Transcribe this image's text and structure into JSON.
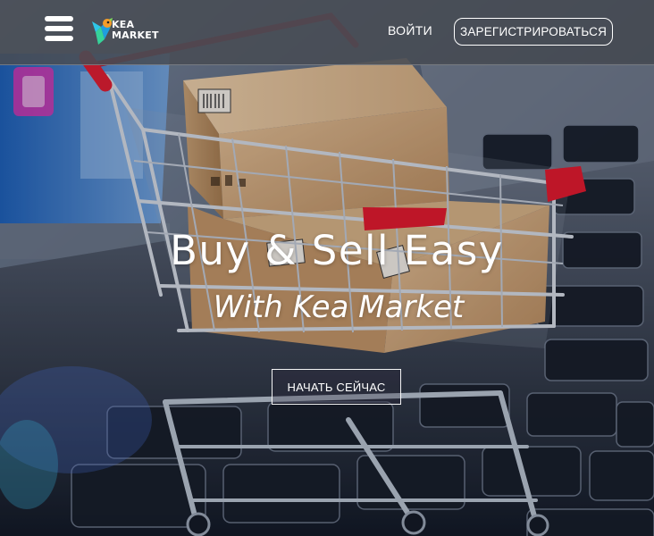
{
  "header": {
    "logo_line1": "KEA",
    "logo_line2": "MARKET",
    "login_label": "ВОЙТИ",
    "register_label": "ЗАРЕГИСТРИРОВАТЬСЯ"
  },
  "hero": {
    "title": "Buy & Sell Easy",
    "subtitle": "With Kea Market",
    "cta_label": "НАЧАТЬ СЕЙЧАС",
    "background_image": "shopping-cart-with-boxes-on-laptop-keyboard"
  },
  "icons": {
    "menu": "hamburger-menu-icon",
    "logo": "kea-bird-logo"
  },
  "colors": {
    "header_bg": "#484c54",
    "text": "#ffffff",
    "cart_handle": "#d8182a"
  }
}
